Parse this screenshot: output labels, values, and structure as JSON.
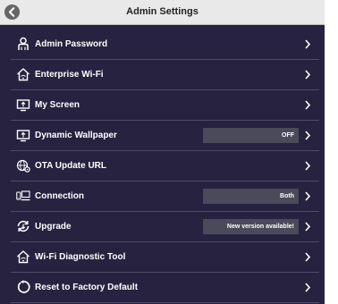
{
  "header": {
    "title": "Admin Settings",
    "back_icon": "back-arrow-icon"
  },
  "settings": [
    {
      "label": "Admin Password",
      "icon": "person-icon",
      "value": null
    },
    {
      "label": "Enterprise Wi-Fi",
      "icon": "home-wifi-icon",
      "value": null
    },
    {
      "label": "My Screen",
      "icon": "screen-icon",
      "value": null
    },
    {
      "label": "Dynamic Wallpaper",
      "icon": "screen-icon",
      "value": "OFF"
    },
    {
      "label": "OTA Update URL",
      "icon": "globe-gear-icon",
      "value": null
    },
    {
      "label": "Connection",
      "icon": "devices-icon",
      "value": "Both"
    },
    {
      "label": "Upgrade",
      "icon": "sync-icon",
      "value": "New version available!"
    },
    {
      "label": "Wi-Fi Diagnostic Tool",
      "icon": "home-wifi-icon",
      "value": null
    },
    {
      "label": "Reset to Factory Default",
      "icon": "reset-icon",
      "value": null
    }
  ],
  "colors": {
    "background": "#26223f",
    "header": "#e9e9e9",
    "value_pill": "#4a4a5a",
    "divider": "#4f4b6a"
  }
}
